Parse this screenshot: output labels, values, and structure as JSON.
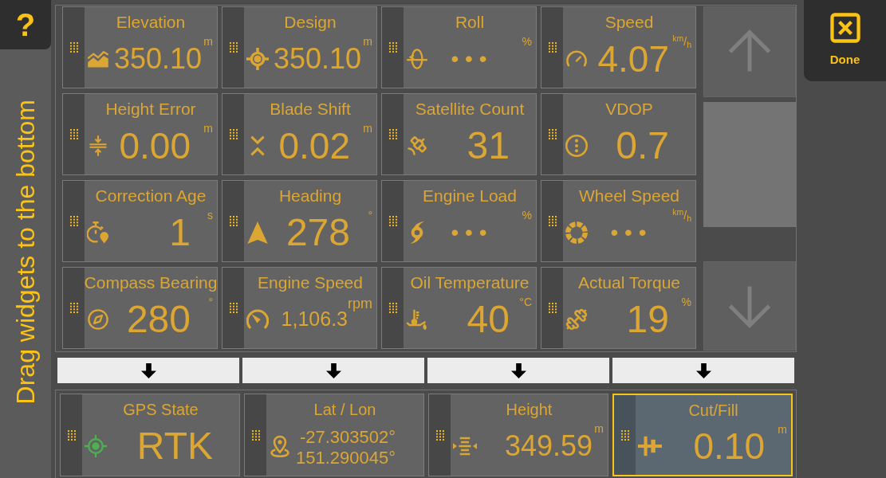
{
  "help_button": {
    "label": "?"
  },
  "instruction": "Drag widgets to the bottom",
  "widgets": [
    {
      "title": "Elevation",
      "kind": "number",
      "value": "350.10",
      "unit": "m"
    },
    {
      "title": "Design",
      "kind": "number",
      "value": "350.10",
      "unit": "m"
    },
    {
      "title": "Roll",
      "kind": "pending",
      "value": "• • •",
      "unit": "%"
    },
    {
      "title": "Speed",
      "kind": "number",
      "value": "4.07",
      "unit": "$^{km}$/$_{h}$"
    },
    {
      "title": "Height Error",
      "kind": "number",
      "value": "0.00",
      "unit": "m"
    },
    {
      "title": "Blade Shift",
      "kind": "number",
      "value": "0.02",
      "unit": "m"
    },
    {
      "title": "Satellite Count",
      "kind": "number",
      "value": "31"
    },
    {
      "title": "VDOP",
      "kind": "number",
      "value": "0.7"
    },
    {
      "title": "Correction Age",
      "kind": "number",
      "value": "1",
      "unit": "s"
    },
    {
      "title": "Heading",
      "kind": "number",
      "value": "278",
      "unit": "°"
    },
    {
      "title": "Engine Load",
      "kind": "pending",
      "value": "• • •",
      "unit": "%"
    },
    {
      "title": "Wheel Speed",
      "kind": "pending",
      "value": "• • •",
      "unit": "$^{km}$/$_{h}$"
    },
    {
      "title": "Compass Bearing",
      "kind": "number",
      "value": "280",
      "unit": "°"
    },
    {
      "title": "Engine Speed",
      "kind": "number",
      "value": "1,106.3",
      "unit": "rpm"
    },
    {
      "title": "Oil Temperature",
      "kind": "number",
      "value": "40",
      "unit": "°C"
    },
    {
      "title": "Actual Torque",
      "kind": "number",
      "value": "19",
      "unit": "%"
    }
  ],
  "bottom_widgets": [
    {
      "title": "GPS State",
      "kind": "number",
      "value": "RTK",
      "selected": false
    },
    {
      "title": "Lat / Lon",
      "kind": "coordinates",
      "values": [
        "-27.303502°",
        "151.290045°"
      ],
      "selected": false
    },
    {
      "title": "Height",
      "kind": "number",
      "value": "349.59",
      "unit": "m",
      "selected": false
    },
    {
      "title": "Cut/Fill",
      "kind": "number",
      "value": "0.10",
      "unit": "m",
      "selected": true
    }
  ],
  "done_button": {
    "label": "Done"
  }
}
